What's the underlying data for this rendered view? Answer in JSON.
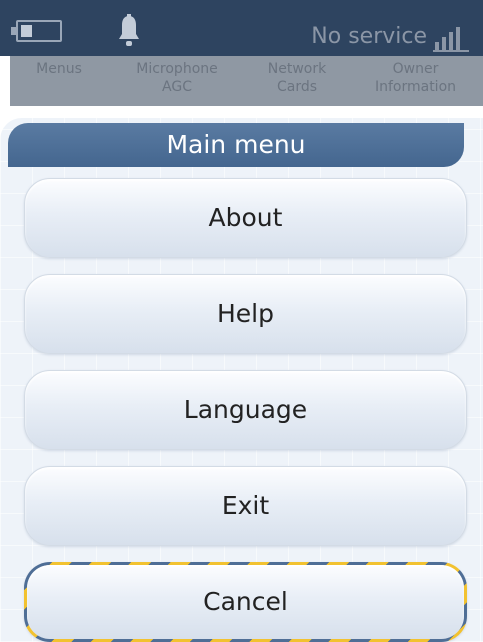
{
  "status_bar": {
    "battery_icon": "battery-icon",
    "bell_icon": "bell-icon",
    "network_status": "No service",
    "signal_icon": "signal-bars-icon"
  },
  "tabs": [
    {
      "line1": "Menus",
      "line2": ""
    },
    {
      "line1": "Microphone",
      "line2": "AGC"
    },
    {
      "line1": "Network",
      "line2": "Cards"
    },
    {
      "line1": "Owner",
      "line2": "Information"
    }
  ],
  "menu": {
    "title": "Main menu",
    "buttons": {
      "about": "About",
      "help": "Help",
      "language": "Language",
      "exit": "Exit",
      "cancel": "Cancel"
    }
  },
  "colors": {
    "status_bar": "#2e4460",
    "header": "#4c6f97",
    "cancel_stripe_yellow": "#f2c230",
    "cancel_stripe_blue": "#4f6e96"
  }
}
